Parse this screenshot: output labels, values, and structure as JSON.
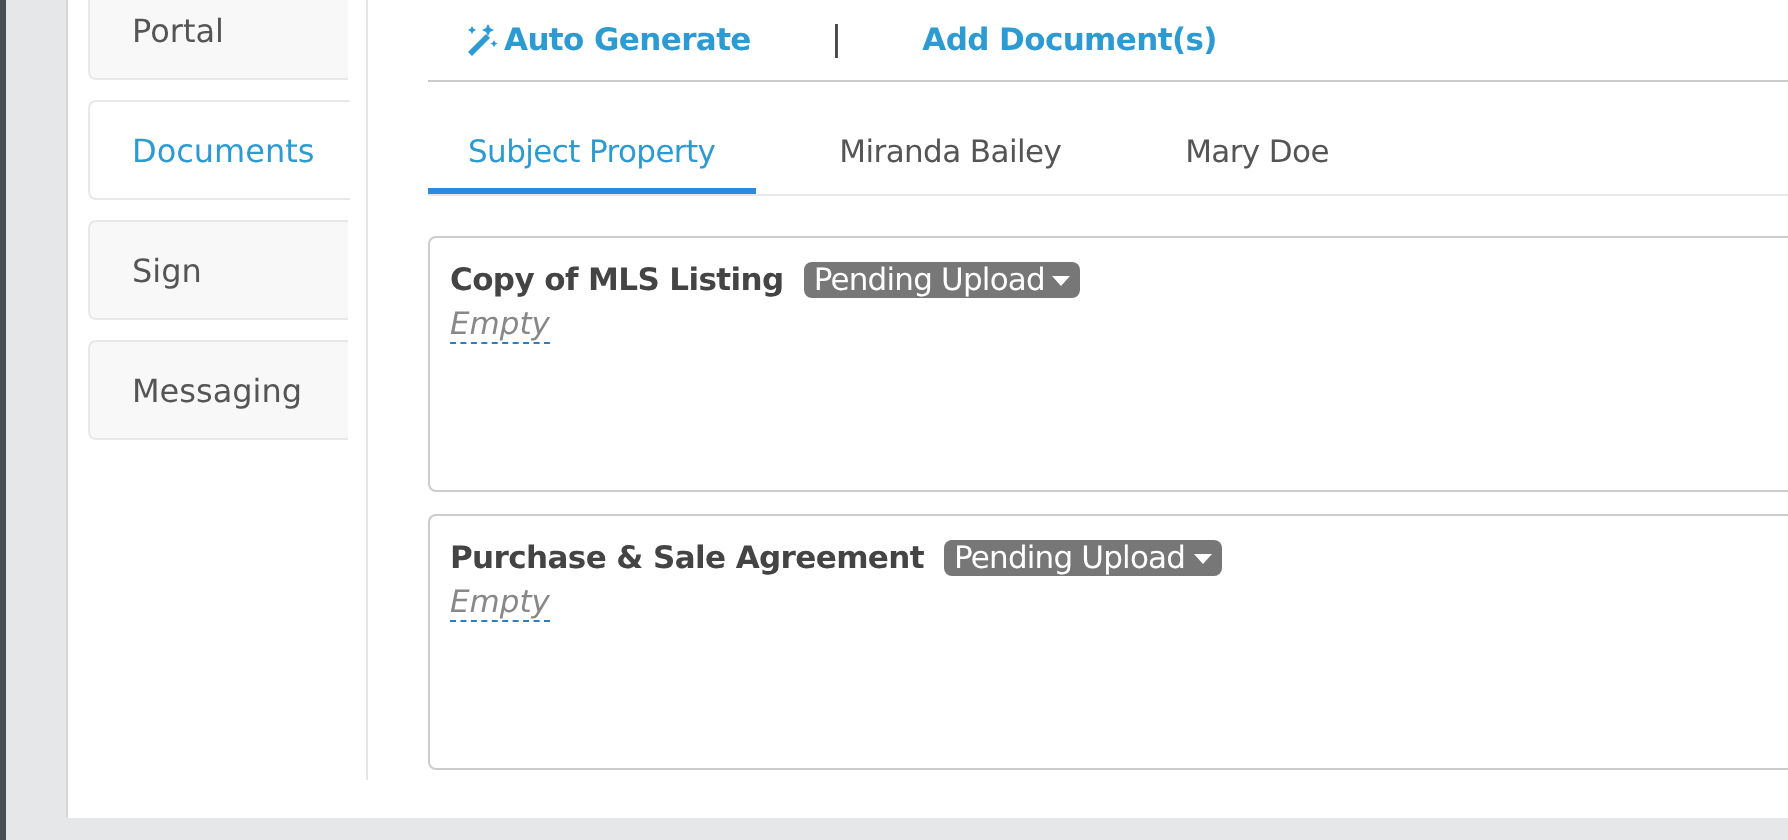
{
  "sidebar": {
    "items": [
      {
        "label": "Portal",
        "selected": false
      },
      {
        "label": "Documents",
        "selected": true
      },
      {
        "label": "Sign",
        "selected": false
      },
      {
        "label": "Messaging",
        "selected": false
      }
    ]
  },
  "toolbar": {
    "auto_generate": "Auto Generate",
    "separator": "|",
    "add_document": "Add Document(s)"
  },
  "tabs": [
    {
      "label": "Subject Property",
      "selected": true
    },
    {
      "label": "Miranda Bailey",
      "selected": false
    },
    {
      "label": "Mary Doe",
      "selected": false
    }
  ],
  "documents": [
    {
      "title": "Copy of MLS Listing",
      "status": "Pending Upload",
      "value": "Empty"
    },
    {
      "title": "Purchase & Sale Agreement",
      "status": "Pending Upload",
      "value": "Empty"
    }
  ]
}
